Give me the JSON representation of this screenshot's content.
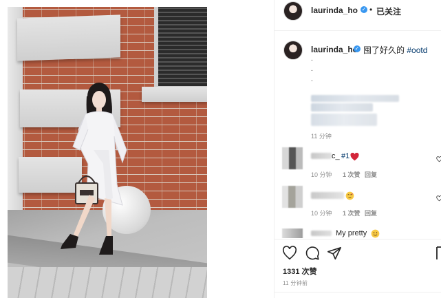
{
  "header": {
    "username": "laurinda_ho",
    "separator": "•",
    "follow_status": "已关注"
  },
  "caption": {
    "username": "laurinda_ho",
    "text": "囤了好久的 ",
    "hashtag": "#ootd",
    "dots": [
      ".",
      ".",
      "."
    ],
    "time": "11 分钟"
  },
  "comments": [
    {
      "user_suffix": "c_",
      "text": "#1",
      "emoji": "heart",
      "time": "10 分钟",
      "likes": "1 次赞",
      "reply": "回复"
    },
    {
      "user_suffix": "",
      "text": "",
      "emoji": "blush",
      "time": "10 分钟",
      "likes": "1 次赞",
      "reply": "回复"
    },
    {
      "user_suffix": "",
      "text": "My pretty",
      "emoji": "smile"
    }
  ],
  "actions": {
    "like_icon": "heart-outline-icon",
    "comment_icon": "comment-bubble-icon",
    "share_icon": "paper-plane-icon",
    "save_icon": "bookmark-icon"
  },
  "likes_count": "1331 次赞",
  "post_time": "11 分钟前",
  "colors": {
    "verified": "#3897f0",
    "hashtag": "#00376b",
    "heart": "#ed4956",
    "muted": "#8e8e8e"
  }
}
